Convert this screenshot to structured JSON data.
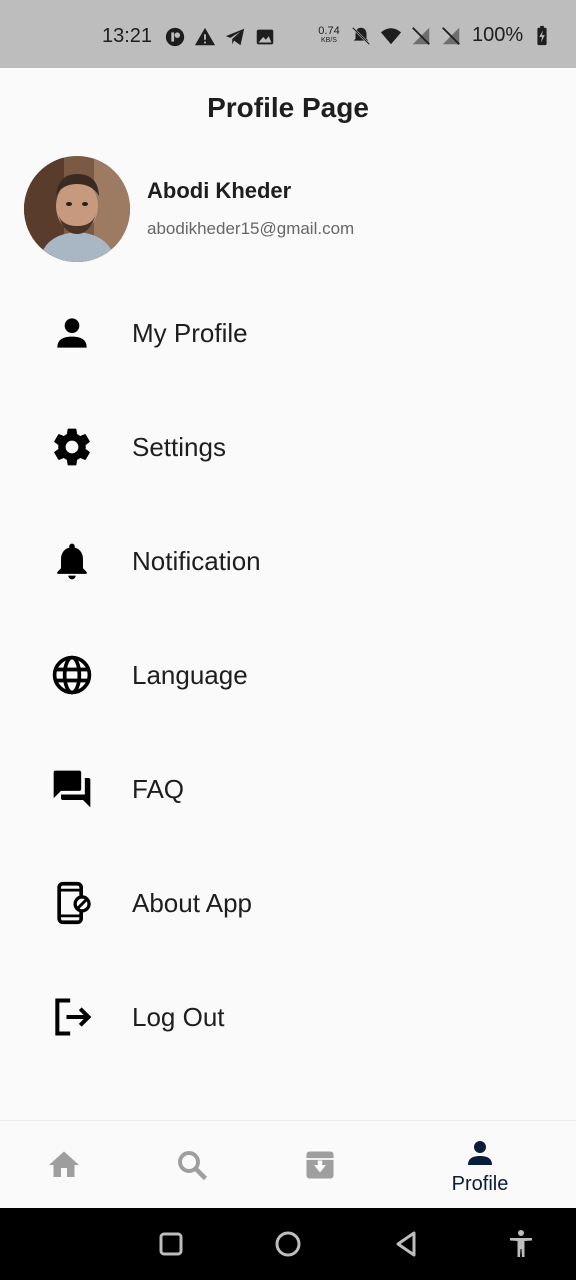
{
  "status_bar": {
    "time": "13:21",
    "network_speed_value": "0.74",
    "network_speed_unit": "KB/S",
    "battery_percent": "100%"
  },
  "header": {
    "title": "Profile Page"
  },
  "profile": {
    "name": "Abodi Kheder",
    "email": "abodikheder15@gmail.com"
  },
  "menu": {
    "items": [
      {
        "label": "My Profile",
        "icon": "person-icon"
      },
      {
        "label": "Settings",
        "icon": "gear-icon"
      },
      {
        "label": "Notification",
        "icon": "bell-icon"
      },
      {
        "label": "Language",
        "icon": "globe-icon"
      },
      {
        "label": "FAQ",
        "icon": "forum-icon"
      },
      {
        "label": "About App",
        "icon": "phone-info-icon"
      },
      {
        "label": "Log Out",
        "icon": "logout-icon"
      }
    ]
  },
  "bottom_nav": {
    "items": [
      {
        "icon": "home-icon",
        "label": ""
      },
      {
        "icon": "search-icon",
        "label": ""
      },
      {
        "icon": "archive-icon",
        "label": ""
      },
      {
        "icon": "person-icon",
        "label": "Profile",
        "active": true
      }
    ]
  },
  "colors": {
    "status_bar_bg": "#bdbdbd",
    "page_bg": "#fafafa",
    "active_nav": "#0b1b3a",
    "inactive_nav": "#9e9e9e"
  }
}
